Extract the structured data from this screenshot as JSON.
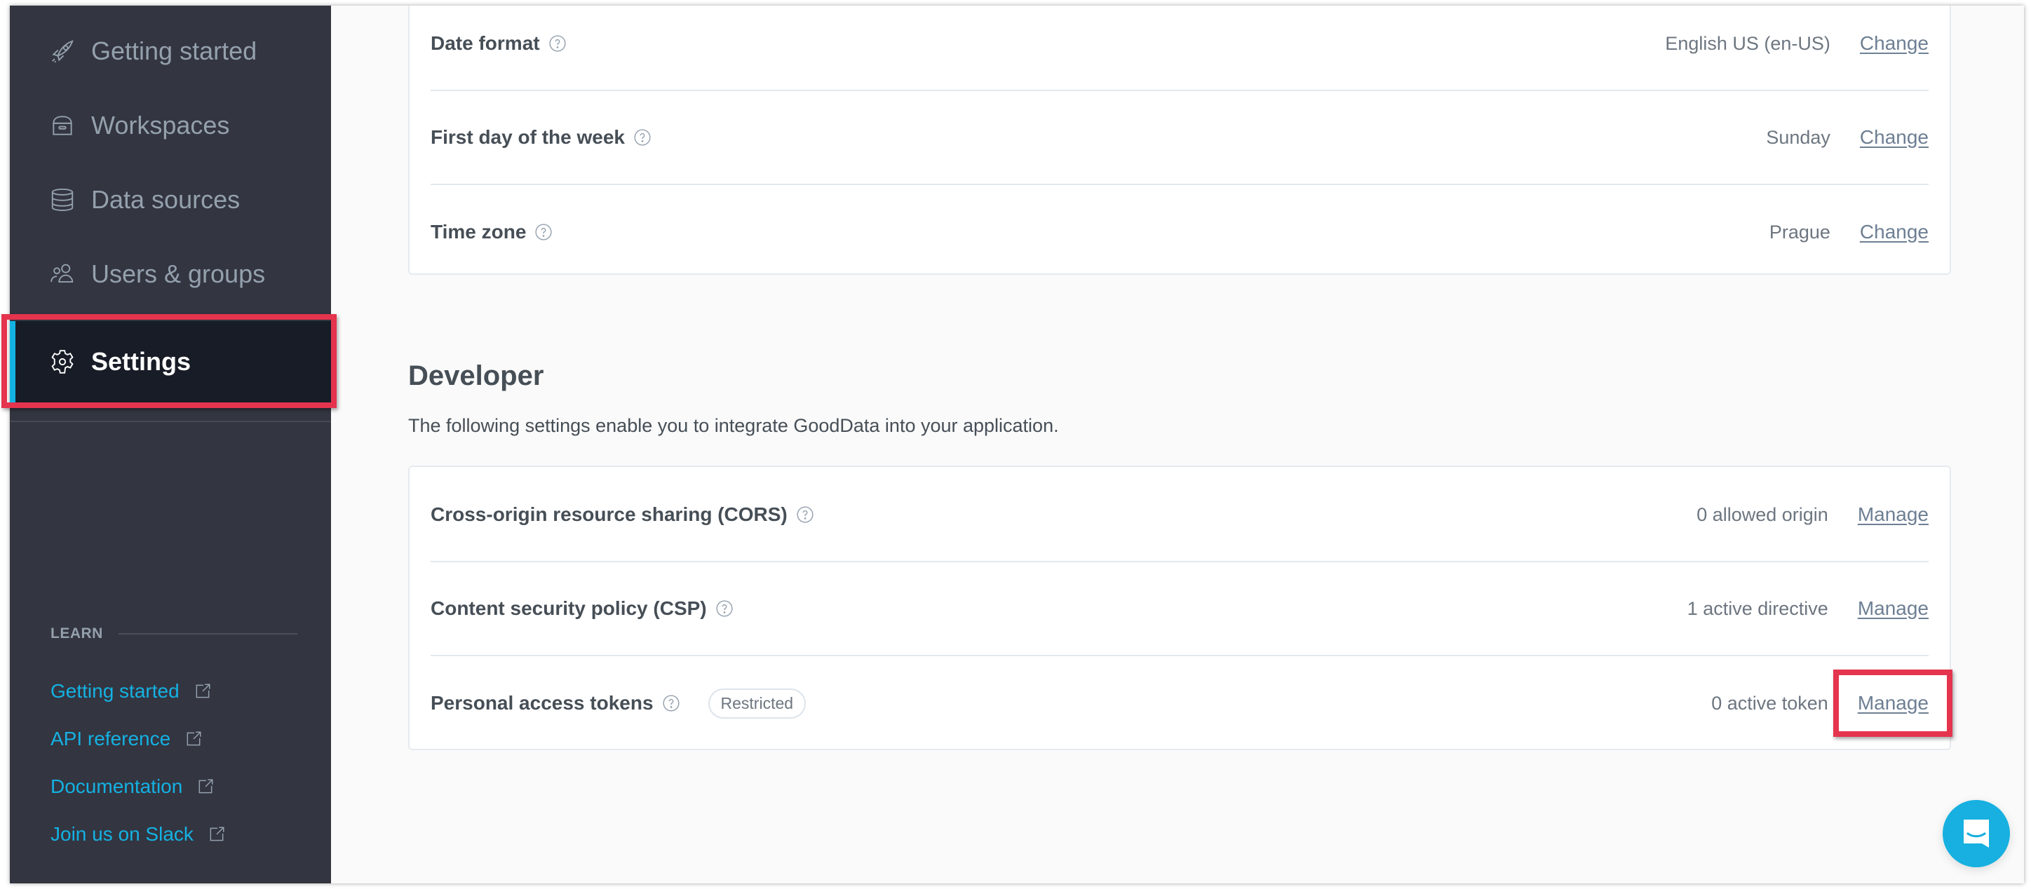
{
  "sidebar": {
    "nav": [
      {
        "label": "Getting started",
        "icon": "rocket-icon",
        "active": false
      },
      {
        "label": "Workspaces",
        "icon": "archive-box-icon",
        "active": false
      },
      {
        "label": "Data sources",
        "icon": "database-icon",
        "active": false
      },
      {
        "label": "Users & groups",
        "icon": "users-icon",
        "active": false
      },
      {
        "label": "Settings",
        "icon": "gear-icon",
        "active": true
      }
    ],
    "learn": {
      "heading": "LEARN",
      "links": [
        {
          "label": "Getting started",
          "icon": "external-link-icon"
        },
        {
          "label": "API reference",
          "icon": "external-link-icon"
        },
        {
          "label": "Documentation",
          "icon": "external-link-icon"
        },
        {
          "label": "Join us on Slack",
          "icon": "external-link-icon"
        }
      ]
    }
  },
  "localization": {
    "rows": [
      {
        "label": "Date format",
        "value": "English US (en-US)",
        "action": "Change"
      },
      {
        "label": "First day of the week",
        "value": "Sunday",
        "action": "Change"
      },
      {
        "label": "Time zone",
        "value": "Prague",
        "action": "Change"
      }
    ]
  },
  "developer": {
    "title": "Developer",
    "description": "The following settings enable you to integrate GoodData into your application.",
    "rows": [
      {
        "label": "Cross-origin resource sharing (CORS)",
        "value": "0 allowed origin",
        "action": "Manage"
      },
      {
        "label": "Content security policy (CSP)",
        "value": "1 active directive",
        "action": "Manage"
      },
      {
        "label": "Personal access tokens",
        "badge": "Restricted",
        "value": "0 active token",
        "action": "Manage"
      }
    ]
  },
  "colors": {
    "accent": "#14b2e2",
    "sidebar_bg": "#333541",
    "sidebar_active_bg": "#171c26",
    "highlight": "#e5344e",
    "link": "#6d7f93"
  },
  "chat": {
    "icon": "chat-bubble-icon"
  }
}
